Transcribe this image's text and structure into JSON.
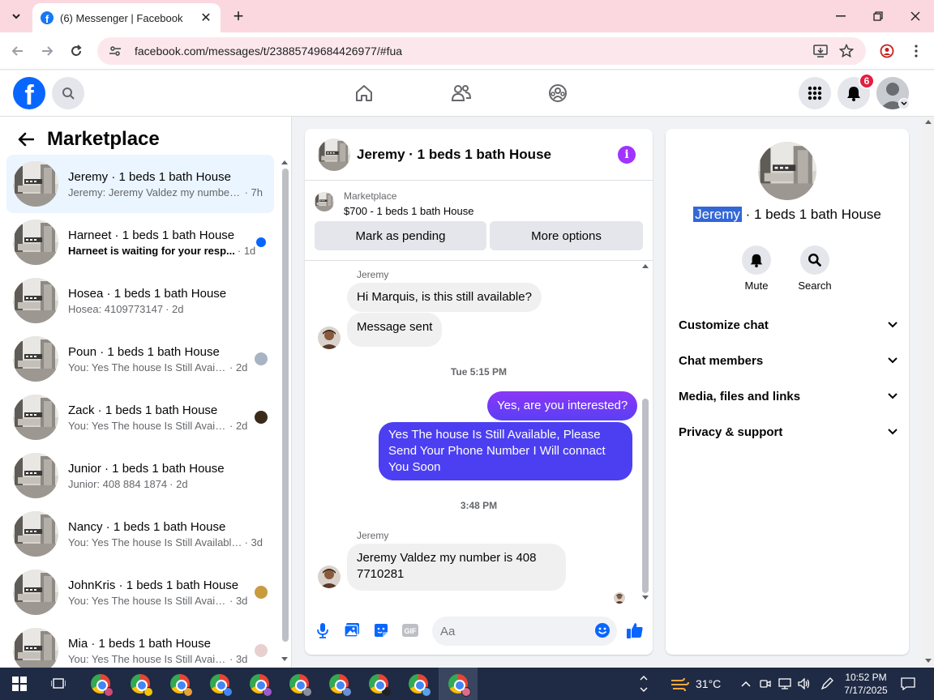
{
  "browser": {
    "tab_title": "(6) Messenger | Facebook",
    "url": "facebook.com/messages/t/23885749684426977/#fua"
  },
  "header": {
    "notification_count": "6"
  },
  "left": {
    "title": "Marketplace",
    "conversations": [
      {
        "name": "Jeremy · 1 beds 1 bath House",
        "snippet": "Jeremy: Jeremy Valdez my number ...",
        "time": "· 7h"
      },
      {
        "name": "Harneet · 1 beds 1 bath House",
        "snippet": "Harneet is waiting for your resp...",
        "time": "· 1d"
      },
      {
        "name": "Hosea · 1 beds 1 bath House",
        "snippet": "Hosea: 4109773147",
        "time": "· 2d"
      },
      {
        "name": "Poun · 1 beds 1 bath House",
        "snippet": "You: Yes The house Is Still Availa...",
        "time": "· 2d"
      },
      {
        "name": "Zack · 1 beds 1 bath House",
        "snippet": "You: Yes The house Is Still Availa...",
        "time": "· 2d"
      },
      {
        "name": "Junior · 1 beds 1 bath House",
        "snippet": "Junior: 408 884 1874",
        "time": "· 2d"
      },
      {
        "name": "Nancy · 1 beds 1 bath House",
        "snippet": "You: Yes The house Is Still Available,...",
        "time": "· 3d"
      },
      {
        "name": "JohnKris · 1 beds 1 bath House",
        "snippet": "You: Yes The house Is Still Availa...",
        "time": "· 3d"
      },
      {
        "name": "Mia · 1 beds 1 bath House",
        "snippet": "You: Yes The house Is Still Availa...",
        "time": "· 3d"
      }
    ]
  },
  "chat": {
    "title": "Jeremy · 1 beds 1 bath House",
    "marketplace_label": "Marketplace",
    "listing": "$700 - 1 beds 1 bath House",
    "mark_pending": "Mark as pending",
    "more_options": "More options",
    "sender1": "Jeremy",
    "msg1": "Hi Marquis, is this still available?",
    "msg2": "Message sent",
    "stamp1": "Tue 5:15 PM",
    "msg3": "Yes, are you interested?",
    "msg4": "Yes The house Is Still Available, Please Send Your Phone Number I Will connact You Soon",
    "stamp2": "3:48 PM",
    "sender2": "Jeremy",
    "msg5": "Jeremy Valdez my number is 408 7710281",
    "composer_placeholder": "Aa"
  },
  "info": {
    "name_highlight": "Jeremy",
    "name_rest": " · 1 beds 1 bath House",
    "mute": "Mute",
    "search": "Search",
    "sections": [
      "Customize chat",
      "Chat members",
      "Media, files and links",
      "Privacy & support"
    ]
  },
  "taskbar": {
    "temperature": "31°C",
    "time": "10:52 PM",
    "date": "7/17/2025"
  },
  "colors": {
    "fb_blue": "#0866ff",
    "messenger_purple": "#a033ff",
    "outgoing_bubble": "#5a3ff5",
    "unread_dot": "#0866ff"
  }
}
